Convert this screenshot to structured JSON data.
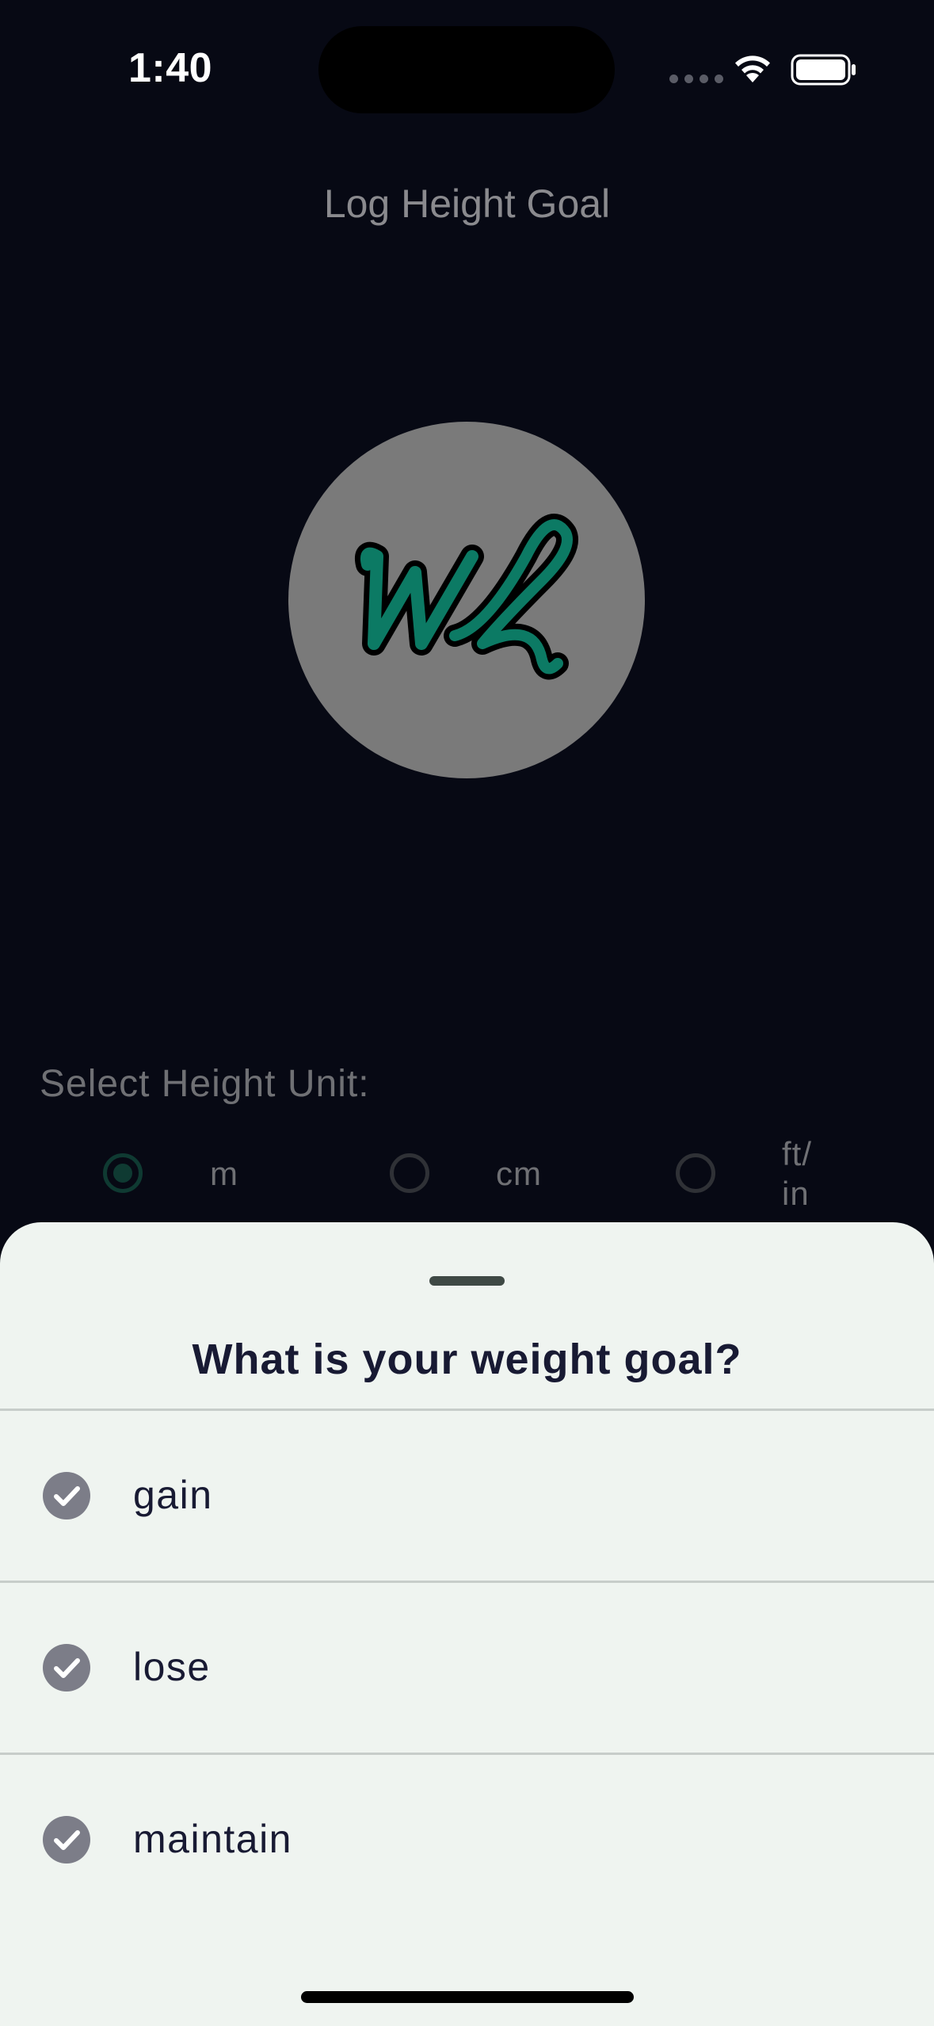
{
  "status_bar": {
    "time": "1:40"
  },
  "header": {
    "title": "Log Height Goal"
  },
  "logo": {
    "text": "WL",
    "circle_color": "#7a7a7a",
    "mark_color": "#0c7a64"
  },
  "unit_selector": {
    "label": "Select Height Unit:",
    "options": [
      {
        "label": "m",
        "selected": true
      },
      {
        "label": "cm",
        "selected": false
      },
      {
        "label": "ft/\nin",
        "selected": false
      }
    ]
  },
  "sheet": {
    "title": "What is your weight goal?",
    "options": [
      {
        "label": "gain",
        "icon": "check-circle-icon"
      },
      {
        "label": "lose",
        "icon": "check-circle-icon"
      },
      {
        "label": "maintain",
        "icon": "check-circle-icon"
      }
    ]
  }
}
